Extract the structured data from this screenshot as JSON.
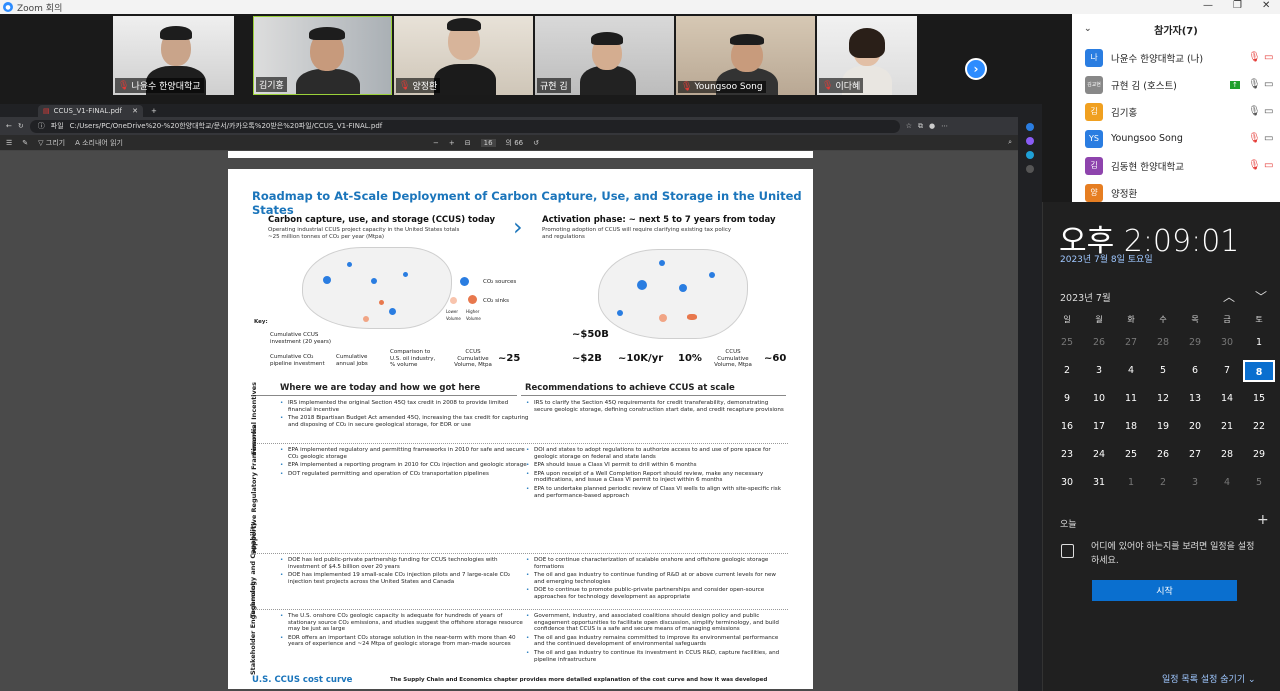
{
  "zoom": {
    "title": "Zoom 회의"
  },
  "participants_tiles": [
    {
      "name": "나윤수 한양대학교",
      "muted": true
    },
    {
      "name": "김기홍",
      "muted": false
    },
    {
      "name": "양정환",
      "muted": true
    },
    {
      "name": "규현 김",
      "muted": false
    },
    {
      "name": "Youngsoo Song",
      "muted": true
    },
    {
      "name": "이다혜",
      "muted": true
    }
  ],
  "panel": {
    "title": "참가자(7)",
    "rows": [
      {
        "initial": "나",
        "name": "나윤수 한양대학교 (나)",
        "color": "#2a7de1"
      },
      {
        "initial": "김교현",
        "name": "규현 김 (호스트)",
        "color": "#888888"
      },
      {
        "initial": "김",
        "name": "김기홍",
        "color": "#f0a020"
      },
      {
        "initial": "YS",
        "name": "Youngsoo Song",
        "color": "#2a7de1"
      },
      {
        "initial": "김",
        "name": "김동현 한양대학교",
        "color": "#8e44ad"
      },
      {
        "initial": "양",
        "name": "양정환",
        "color": "#e67e22"
      }
    ]
  },
  "browser": {
    "tab": "CCUS_V1-FINAL.pdf",
    "url_prefix": "파일",
    "url": "C:/Users/PC/OneDrive%20-%20한양대학교/문서/카카오톡%20받은%20파일/CCUS_V1-FINAL.pdf",
    "tool_draw": "그리기",
    "tool_read": "소리내어 읽기",
    "page_num": "16",
    "page_total": "의 66"
  },
  "doc": {
    "title": "Roadmap to At-Scale Deployment of Carbon Capture, Use, and Storage in the United States",
    "left_h": "Carbon capture, use, and storage (CCUS) today",
    "left_sub1": "Operating industrial CCUS project capacity in the United States totals",
    "left_sub2": "~25 million tonnes of CO₂ per year (Mtpa)",
    "right_h": "Activation phase: ~ next 5 to 7 years from today",
    "right_sub1": "Promoting adoption of CCUS will require clarifying existing tax policy",
    "right_sub2": "and regulations",
    "legend_sources": "CO₂ sources",
    "legend_sinks": "CO₂ sinks",
    "legend_lower": "Lower Volume",
    "legend_higher": "Higher Volume",
    "key": "Key:",
    "key_invest": "Cumulative CCUS investment (20 years)",
    "key_pipe": "Cumulative CO₂ pipeline investment",
    "key_jobs": "Cumulative annual jobs",
    "key_comp": "Comparison to U.S. oil industry, % volume",
    "key_vol": "CCUS Cumulative Volume, Mtpa",
    "today_vol": "~25",
    "act_invest": "~$50B",
    "act_pipe": "~$2B",
    "act_jobs": "~10K/yr",
    "act_pct": "10%",
    "act_vol": "~60",
    "where_h": "Where we are today and how we got here",
    "rec_h": "Recommendations to achieve CCUS at scale",
    "rows": [
      {
        "label": "Financial Incentives",
        "left": [
          "IRS implemented the original Section 45Q tax credit in 2008 to provide limited financial incentive",
          "The 2018 Bipartisan Budget Act amended 45Q, increasing the tax credit for capturing and disposing of CO₂ in secure geological storage, for EOR or use"
        ],
        "right": [
          "IRS to clarify the Section 45Q requirements for credit transferability, demonstrating secure geologic storage, defining construction start date, and credit recapture provisions"
        ]
      },
      {
        "label": "Supportive Regulatory Frameworks",
        "left": [
          "EPA implemented regulatory and permitting frameworks in 2010 for safe and secure CO₂ geologic storage",
          "EPA implemented a reporting program in 2010 for CO₂ injection and geologic storage",
          "DOT regulated permitting and operation of CO₂ transportation pipelines"
        ],
        "right": [
          "DOI and states to adopt regulations to authorize access to and use of pore space for geologic storage on federal and state lands",
          "EPA should issue a Class VI permit to drill within 6 months",
          "EPA upon receipt of a Well Completion Report should review, make any necessary modifications, and issue a Class VI permit to inject within 6 months",
          "EPA to undertake planned periodic review of Class VI wells to align with site-specific risk and performance-based approach"
        ]
      },
      {
        "label": "Technology and Capability",
        "left": [
          "DOE has led public-private partnership funding for CCUS technologies with investment of $4.5 billion over 20 years",
          "DOE has implemented 19 small-scale CO₂ injection pilots and 7 large-scale CO₂ injection test projects across the United States and Canada"
        ],
        "right": [
          "DOE to continue characterization of scalable onshore and offshore geologic storage formations",
          "The oil and gas industry to continue funding of R&D at or above current levels for new and emerging technologies",
          "DOE to continue to promote public-private partnerships and consider open-source approaches for technology development as appropriate"
        ]
      },
      {
        "label": "Stakeholder Engagement",
        "left": [
          "The U.S. onshore CO₂ geologic capacity is adequate for hundreds of years of stationary source CO₂ emissions, and studies suggest the offshore storage resource may be just as large",
          "EOR offers an important CO₂ storage solution in the near-term with more than 40 years of experience and ~24 Mtpa of geologic storage from man-made sources"
        ],
        "right": [
          "Government, industry, and associated coalitions should design policy and public engagement opportunities to facilitate open discussion, simplify terminology, and build confidence that CCUS is a safe and secure means of managing emissions",
          "The oil and gas industry remains committed to improve its environmental performance and the continued development of environmental safeguards",
          "The oil and gas industry to continue its investment in CCUS R&D, capture facilities, and pipeline infrastructure"
        ]
      }
    ],
    "footer_h": "U.S. CCUS cost curve",
    "footer_t": "The Supply Chain and Economics chapter provides more detailed explanation of the cost curve and how it was developed"
  },
  "clock": {
    "time": "오후 2:09:01",
    "date": "2023년 7월 8일 토요일",
    "month": "2023년 7월",
    "weekdays": [
      "일",
      "월",
      "화",
      "수",
      "목",
      "금",
      "토"
    ],
    "days": [
      "25",
      "26",
      "27",
      "28",
      "29",
      "30",
      "1",
      "2",
      "3",
      "4",
      "5",
      "6",
      "7",
      "8",
      "9",
      "10",
      "11",
      "12",
      "13",
      "14",
      "15",
      "16",
      "17",
      "18",
      "19",
      "20",
      "21",
      "22",
      "23",
      "24",
      "25",
      "26",
      "27",
      "28",
      "29",
      "30",
      "31",
      "1",
      "2",
      "3",
      "4",
      "5"
    ],
    "selected_index": 13,
    "today": "오늘",
    "hint": "어디에 있어야 하는지를 보려면 일정을 설정하세요.",
    "start": "시작",
    "hide": "일정 목록 설정 숨기기"
  }
}
